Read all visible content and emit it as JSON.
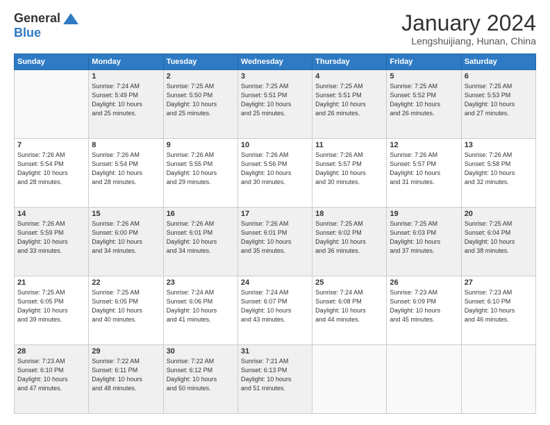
{
  "header": {
    "logo_general": "General",
    "logo_blue": "Blue",
    "title": "January 2024",
    "location": "Lengshuijiang, Hunan, China"
  },
  "days_of_week": [
    "Sunday",
    "Monday",
    "Tuesday",
    "Wednesday",
    "Thursday",
    "Friday",
    "Saturday"
  ],
  "weeks": [
    [
      {
        "num": "",
        "info": ""
      },
      {
        "num": "1",
        "info": "Sunrise: 7:24 AM\nSunset: 5:49 PM\nDaylight: 10 hours\nand 25 minutes."
      },
      {
        "num": "2",
        "info": "Sunrise: 7:25 AM\nSunset: 5:50 PM\nDaylight: 10 hours\nand 25 minutes."
      },
      {
        "num": "3",
        "info": "Sunrise: 7:25 AM\nSunset: 5:51 PM\nDaylight: 10 hours\nand 25 minutes."
      },
      {
        "num": "4",
        "info": "Sunrise: 7:25 AM\nSunset: 5:51 PM\nDaylight: 10 hours\nand 26 minutes."
      },
      {
        "num": "5",
        "info": "Sunrise: 7:25 AM\nSunset: 5:52 PM\nDaylight: 10 hours\nand 26 minutes."
      },
      {
        "num": "6",
        "info": "Sunrise: 7:25 AM\nSunset: 5:53 PM\nDaylight: 10 hours\nand 27 minutes."
      }
    ],
    [
      {
        "num": "7",
        "info": "Sunrise: 7:26 AM\nSunset: 5:54 PM\nDaylight: 10 hours\nand 28 minutes."
      },
      {
        "num": "8",
        "info": "Sunrise: 7:26 AM\nSunset: 5:54 PM\nDaylight: 10 hours\nand 28 minutes."
      },
      {
        "num": "9",
        "info": "Sunrise: 7:26 AM\nSunset: 5:55 PM\nDaylight: 10 hours\nand 29 minutes."
      },
      {
        "num": "10",
        "info": "Sunrise: 7:26 AM\nSunset: 5:56 PM\nDaylight: 10 hours\nand 30 minutes."
      },
      {
        "num": "11",
        "info": "Sunrise: 7:26 AM\nSunset: 5:57 PM\nDaylight: 10 hours\nand 30 minutes."
      },
      {
        "num": "12",
        "info": "Sunrise: 7:26 AM\nSunset: 5:57 PM\nDaylight: 10 hours\nand 31 minutes."
      },
      {
        "num": "13",
        "info": "Sunrise: 7:26 AM\nSunset: 5:58 PM\nDaylight: 10 hours\nand 32 minutes."
      }
    ],
    [
      {
        "num": "14",
        "info": "Sunrise: 7:26 AM\nSunset: 5:59 PM\nDaylight: 10 hours\nand 33 minutes."
      },
      {
        "num": "15",
        "info": "Sunrise: 7:26 AM\nSunset: 6:00 PM\nDaylight: 10 hours\nand 34 minutes."
      },
      {
        "num": "16",
        "info": "Sunrise: 7:26 AM\nSunset: 6:01 PM\nDaylight: 10 hours\nand 34 minutes."
      },
      {
        "num": "17",
        "info": "Sunrise: 7:26 AM\nSunset: 6:01 PM\nDaylight: 10 hours\nand 35 minutes."
      },
      {
        "num": "18",
        "info": "Sunrise: 7:25 AM\nSunset: 6:02 PM\nDaylight: 10 hours\nand 36 minutes."
      },
      {
        "num": "19",
        "info": "Sunrise: 7:25 AM\nSunset: 6:03 PM\nDaylight: 10 hours\nand 37 minutes."
      },
      {
        "num": "20",
        "info": "Sunrise: 7:25 AM\nSunset: 6:04 PM\nDaylight: 10 hours\nand 38 minutes."
      }
    ],
    [
      {
        "num": "21",
        "info": "Sunrise: 7:25 AM\nSunset: 6:05 PM\nDaylight: 10 hours\nand 39 minutes."
      },
      {
        "num": "22",
        "info": "Sunrise: 7:25 AM\nSunset: 6:05 PM\nDaylight: 10 hours\nand 40 minutes."
      },
      {
        "num": "23",
        "info": "Sunrise: 7:24 AM\nSunset: 6:06 PM\nDaylight: 10 hours\nand 41 minutes."
      },
      {
        "num": "24",
        "info": "Sunrise: 7:24 AM\nSunset: 6:07 PM\nDaylight: 10 hours\nand 43 minutes."
      },
      {
        "num": "25",
        "info": "Sunrise: 7:24 AM\nSunset: 6:08 PM\nDaylight: 10 hours\nand 44 minutes."
      },
      {
        "num": "26",
        "info": "Sunrise: 7:23 AM\nSunset: 6:09 PM\nDaylight: 10 hours\nand 45 minutes."
      },
      {
        "num": "27",
        "info": "Sunrise: 7:23 AM\nSunset: 6:10 PM\nDaylight: 10 hours\nand 46 minutes."
      }
    ],
    [
      {
        "num": "28",
        "info": "Sunrise: 7:23 AM\nSunset: 6:10 PM\nDaylight: 10 hours\nand 47 minutes."
      },
      {
        "num": "29",
        "info": "Sunrise: 7:22 AM\nSunset: 6:11 PM\nDaylight: 10 hours\nand 48 minutes."
      },
      {
        "num": "30",
        "info": "Sunrise: 7:22 AM\nSunset: 6:12 PM\nDaylight: 10 hours\nand 50 minutes."
      },
      {
        "num": "31",
        "info": "Sunrise: 7:21 AM\nSunset: 6:13 PM\nDaylight: 10 hours\nand 51 minutes."
      },
      {
        "num": "",
        "info": ""
      },
      {
        "num": "",
        "info": ""
      },
      {
        "num": "",
        "info": ""
      }
    ]
  ]
}
